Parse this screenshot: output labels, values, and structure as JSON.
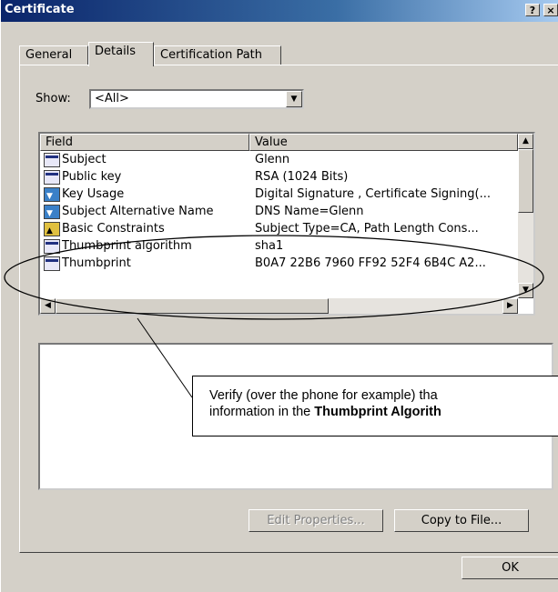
{
  "window": {
    "title": "Certificate",
    "help_button": "?",
    "close_button": "×"
  },
  "tabs": [
    {
      "label": "General",
      "active": false
    },
    {
      "label": "Details",
      "active": true
    },
    {
      "label": "Certification Path",
      "active": false
    }
  ],
  "show": {
    "label": "Show:",
    "value": "<All>"
  },
  "fields_table": {
    "columns": [
      "Field",
      "Value"
    ],
    "rows": [
      {
        "icon": "cert-field-icon",
        "field": "Subject",
        "value": "Glenn"
      },
      {
        "icon": "cert-field-icon",
        "field": "Public key",
        "value": "RSA (1024 Bits)"
      },
      {
        "icon": "extension-icon",
        "field": "Key Usage",
        "value": "Digital Signature , Certificate Signing(..."
      },
      {
        "icon": "extension-icon",
        "field": "Subject Alternative Name",
        "value": "DNS Name=Glenn"
      },
      {
        "icon": "warning-extension-icon",
        "field": "Basic Constraints",
        "value": "Subject Type=CA, Path Length Cons..."
      },
      {
        "icon": "thumbprint-icon",
        "field": "Thumbprint algorithm",
        "value": "sha1"
      },
      {
        "icon": "thumbprint-icon",
        "field": "Thumbprint",
        "value": "B0A7 22B6 7960 FF92 52F4 6B4C A2..."
      }
    ]
  },
  "buttons": {
    "edit_properties": "Edit Properties...",
    "copy_to_file": "Copy to File...",
    "ok": "OK"
  },
  "callout": {
    "line1": "Verify (over the phone for example) tha",
    "line2_prefix": "information in the ",
    "line2_bold": "Thumbprint Algorith"
  },
  "colors": {
    "title_bar": "#0a246a",
    "dialog_face": "#d4d0c8",
    "annotation_ellipse": "#000000"
  }
}
